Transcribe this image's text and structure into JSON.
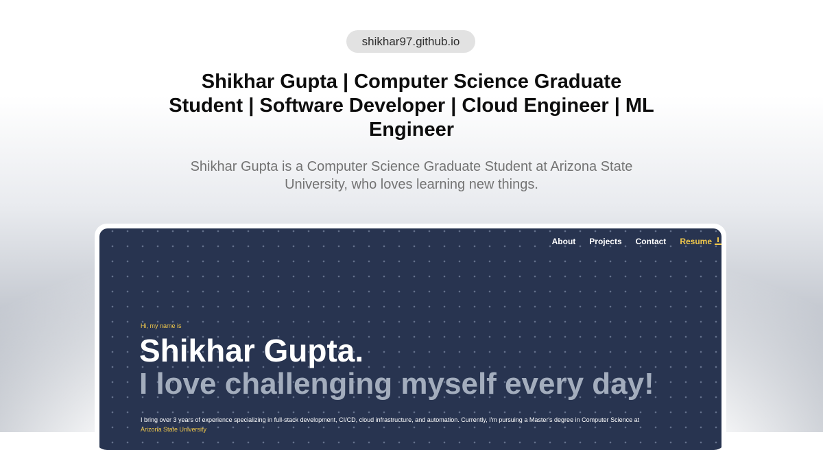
{
  "site": {
    "domain": "shikhar97.github.io",
    "title": "Shikhar Gupta | Computer Science Graduate Student | Software Developer | Cloud Engineer | ML Engineer",
    "description": "Shikhar Gupta is a Computer Science Graduate Student at Arizona State University, who loves learning new things."
  },
  "preview": {
    "nav": {
      "items": [
        "About",
        "Projects",
        "Contact"
      ],
      "resume_label": "Resume"
    },
    "hero": {
      "greeting": "Hi, my name is",
      "name": "Shikhar Gupta.",
      "tagline": "I love challenging myself every day!",
      "intro": "I bring over 3 years of experience specializing in full-stack development, CI/CD, cloud infrastructure, and automation. Currently, I'm pursuing a Master's degree in Computer Science at",
      "university_link": "Arizona State University"
    }
  },
  "colors": {
    "accent": "#f1c84b",
    "panel_bg": "#283450",
    "tagline": "#a3adbd"
  },
  "icons": {
    "resume": "download-icon"
  }
}
